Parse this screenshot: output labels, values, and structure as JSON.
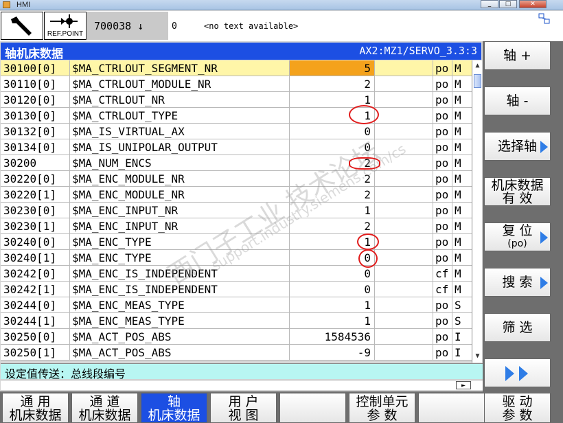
{
  "window": {
    "title": "HMI"
  },
  "header": {
    "ref_point_label": "REF.POINT",
    "program_number": "700038 ↓",
    "alarm_number": "0",
    "alarm_text": "<no text available>"
  },
  "table": {
    "title": "轴机床数据",
    "axis_info": "AX2:MZ1/SERVO_3.3:3",
    "selected_row": 0,
    "rows": [
      {
        "id": "30100[0]",
        "name": "$MA_CTRLOUT_SEGMENT_NR",
        "value": "5",
        "unit": "po",
        "cls": "M"
      },
      {
        "id": "30110[0]",
        "name": "$MA_CTRLOUT_MODULE_NR",
        "value": "2",
        "unit": "po",
        "cls": "M"
      },
      {
        "id": "30120[0]",
        "name": "$MA_CTRLOUT_NR",
        "value": "1",
        "unit": "po",
        "cls": "M"
      },
      {
        "id": "30130[0]",
        "name": "$MA_CTRLOUT_TYPE",
        "value": "1",
        "unit": "po",
        "cls": "M"
      },
      {
        "id": "30132[0]",
        "name": "$MA_IS_VIRTUAL_AX",
        "value": "0",
        "unit": "po",
        "cls": "M"
      },
      {
        "id": "30134[0]",
        "name": "$MA_IS_UNIPOLAR_OUTPUT",
        "value": "0",
        "unit": "po",
        "cls": "M"
      },
      {
        "id": "30200",
        "name": "$MA_NUM_ENCS",
        "value": "2",
        "unit": "po",
        "cls": "M"
      },
      {
        "id": "30220[0]",
        "name": "$MA_ENC_MODULE_NR",
        "value": "2",
        "unit": "po",
        "cls": "M"
      },
      {
        "id": "30220[1]",
        "name": "$MA_ENC_MODULE_NR",
        "value": "2",
        "unit": "po",
        "cls": "M"
      },
      {
        "id": "30230[0]",
        "name": "$MA_ENC_INPUT_NR",
        "value": "1",
        "unit": "po",
        "cls": "M"
      },
      {
        "id": "30230[1]",
        "name": "$MA_ENC_INPUT_NR",
        "value": "2",
        "unit": "po",
        "cls": "M"
      },
      {
        "id": "30240[0]",
        "name": "$MA_ENC_TYPE",
        "value": "1",
        "unit": "po",
        "cls": "M"
      },
      {
        "id": "30240[1]",
        "name": "$MA_ENC_TYPE",
        "value": "0",
        "unit": "po",
        "cls": "M"
      },
      {
        "id": "30242[0]",
        "name": "$MA_ENC_IS_INDEPENDENT",
        "value": "0",
        "unit": "cf",
        "cls": "M"
      },
      {
        "id": "30242[1]",
        "name": "$MA_ENC_IS_INDEPENDENT",
        "value": "0",
        "unit": "cf",
        "cls": "M"
      },
      {
        "id": "30244[0]",
        "name": "$MA_ENC_MEAS_TYPE",
        "value": "1",
        "unit": "po",
        "cls": "S"
      },
      {
        "id": "30244[1]",
        "name": "$MA_ENC_MEAS_TYPE",
        "value": "1",
        "unit": "po",
        "cls": "S"
      },
      {
        "id": "30250[0]",
        "name": "$MA_ACT_POS_ABS",
        "value": "1584536",
        "unit": "po",
        "cls": "I"
      },
      {
        "id": "30250[1]",
        "name": "$MA_ACT_POS_ABS",
        "value": "-9",
        "unit": "po",
        "cls": "I"
      }
    ]
  },
  "status_line": "设定值传送：总线段编号",
  "watermark": {
    "line1": "西门子工业 技术论坛",
    "line2": "support.industry.siemens.com/cs"
  },
  "vertical_softkeys": [
    {
      "l1": "轴 +",
      "l2": ""
    },
    {
      "l1": "轴 -",
      "l2": ""
    },
    {
      "l1": "选择轴",
      "l2": ""
    },
    {
      "l1": "机床数据",
      "l2": "有  效"
    },
    {
      "l1": "复 位",
      "l2": "(po)"
    },
    {
      "l1": "搜 索",
      "l2": ""
    },
    {
      "l1": "筛 选",
      "l2": ""
    }
  ],
  "horizontal_softkeys": [
    {
      "l1": "通  用",
      "l2": "机床数据"
    },
    {
      "l1": "通  道",
      "l2": "机床数据"
    },
    {
      "l1": "轴",
      "l2": "机床数据"
    },
    {
      "l1": "用 户",
      "l2": "视 图"
    },
    {
      "l1": "",
      "l2": ""
    },
    {
      "l1": "控制单元",
      "l2": "参  数"
    },
    {
      "l1": "",
      "l2": ""
    },
    {
      "l1": "驱 动",
      "l2": "参 数"
    }
  ],
  "colors": {
    "accent": "#1c4fe3",
    "selected_row": "#fff6a8",
    "selected_value": "#f4a21c",
    "status_bg": "#b8f6f2",
    "annotation": "#e01b1b"
  }
}
